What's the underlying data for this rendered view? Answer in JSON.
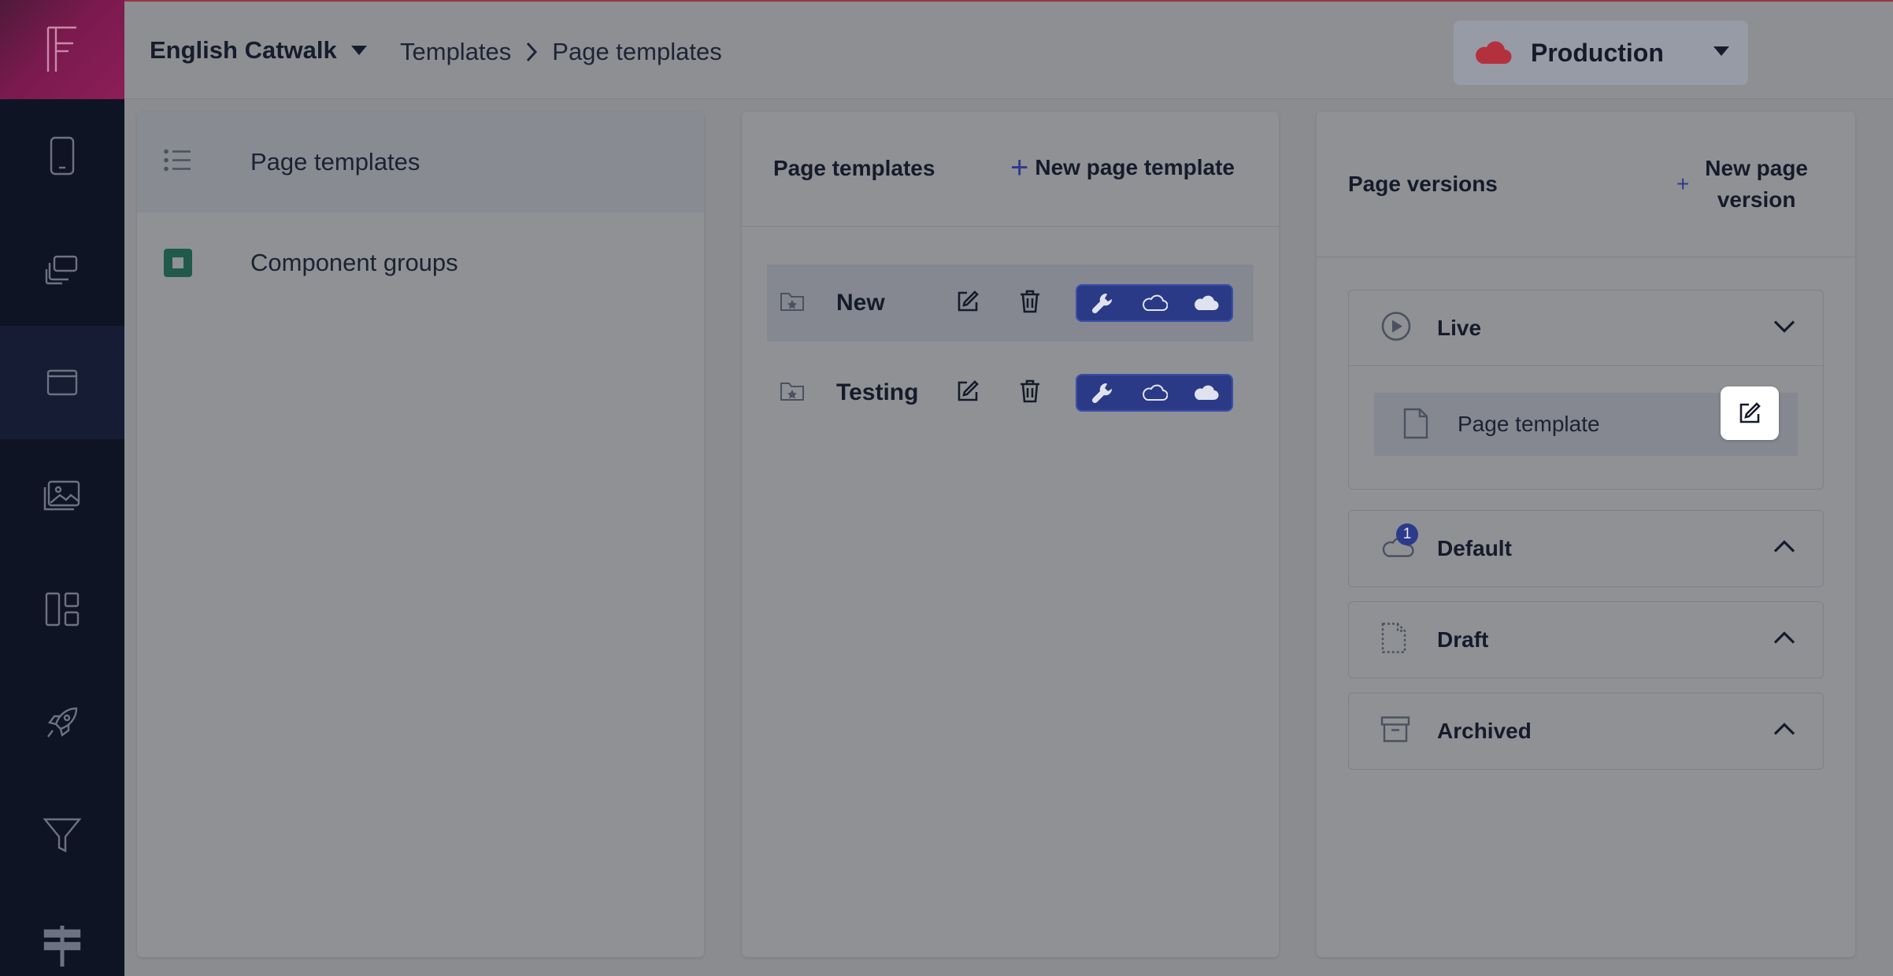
{
  "header": {
    "project": "English Catwalk",
    "breadcrumb": [
      "Templates",
      "Page templates"
    ],
    "environment": "Production"
  },
  "rail": {
    "items": [
      "mobile-icon",
      "copy-icon",
      "window-icon",
      "images-icon",
      "layout-icon",
      "rocket-icon",
      "filter-icon",
      "signpost-icon"
    ],
    "active_index": 2
  },
  "nav": {
    "items": [
      {
        "label": "Page templates",
        "icon": "list-icon",
        "active": true
      },
      {
        "label": "Component groups",
        "icon": "component-icon",
        "active": false
      }
    ]
  },
  "templates_panel": {
    "title": "Page templates",
    "new_label": "New page template",
    "rows": [
      {
        "name": "New",
        "active": true
      },
      {
        "name": "Testing",
        "active": false
      }
    ]
  },
  "versions_panel": {
    "title": "Page versions",
    "new_label_line1": "New page",
    "new_label_line2": "version",
    "groups": [
      {
        "label": "Live",
        "expanded": true,
        "items": [
          "Page template"
        ]
      },
      {
        "label": "Default",
        "badge": "1",
        "expanded": false
      },
      {
        "label": "Draft",
        "expanded": false
      },
      {
        "label": "Archived",
        "expanded": false
      }
    ]
  },
  "colors": {
    "rail": "#0f1424",
    "accent": "#2b3a8a",
    "brand_gradient": "#7a1a4e",
    "production_cloud": "#b5303e"
  }
}
